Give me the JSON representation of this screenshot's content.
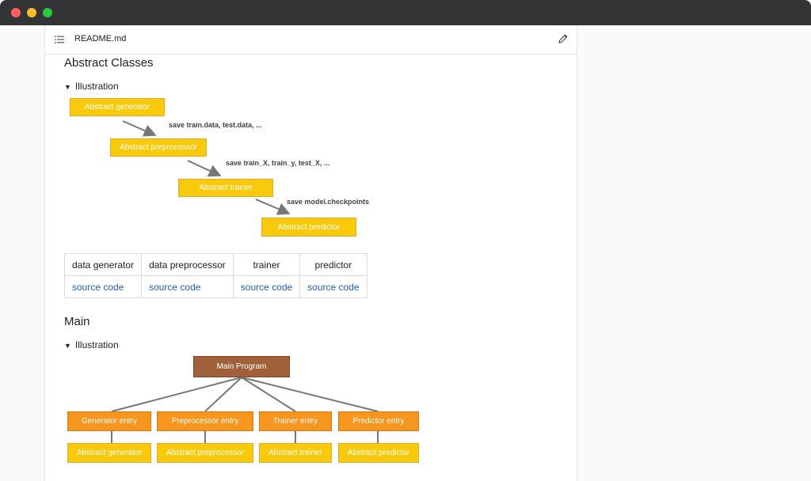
{
  "file": {
    "name": "README.md"
  },
  "sections": {
    "abstract": {
      "heading": "Abstract Classes",
      "summary": "Illustration"
    },
    "main": {
      "heading": "Main",
      "summary": "Illustration"
    }
  },
  "diagram1": {
    "boxes": [
      "Abstract generator",
      "Abstract preprocessor",
      "Abstract trainer",
      "Abstract predictor"
    ],
    "edges": [
      "save train.data, test.data, ...",
      "save train_X, train_y, test_X, ...",
      "save model.checkpoints"
    ]
  },
  "table": {
    "headers": [
      "data generator",
      "data preprocessor",
      "trainer",
      "predictor"
    ],
    "links": [
      "source code",
      "source code",
      "source code",
      "source code"
    ]
  },
  "diagram2": {
    "root": "Main Program",
    "entries": [
      "Generator entry",
      "Preprocessor entry",
      "Trainer entry",
      "Predictor entry"
    ],
    "abstracts": [
      "Abstract generator",
      "Abstract preprocessor",
      "Abstract trainer",
      "Abstract predictor"
    ]
  },
  "colors": {
    "yellow": "#f9c90c",
    "orange": "#f6961e",
    "brown": "#a0613a",
    "link": "#1f5fb8"
  }
}
